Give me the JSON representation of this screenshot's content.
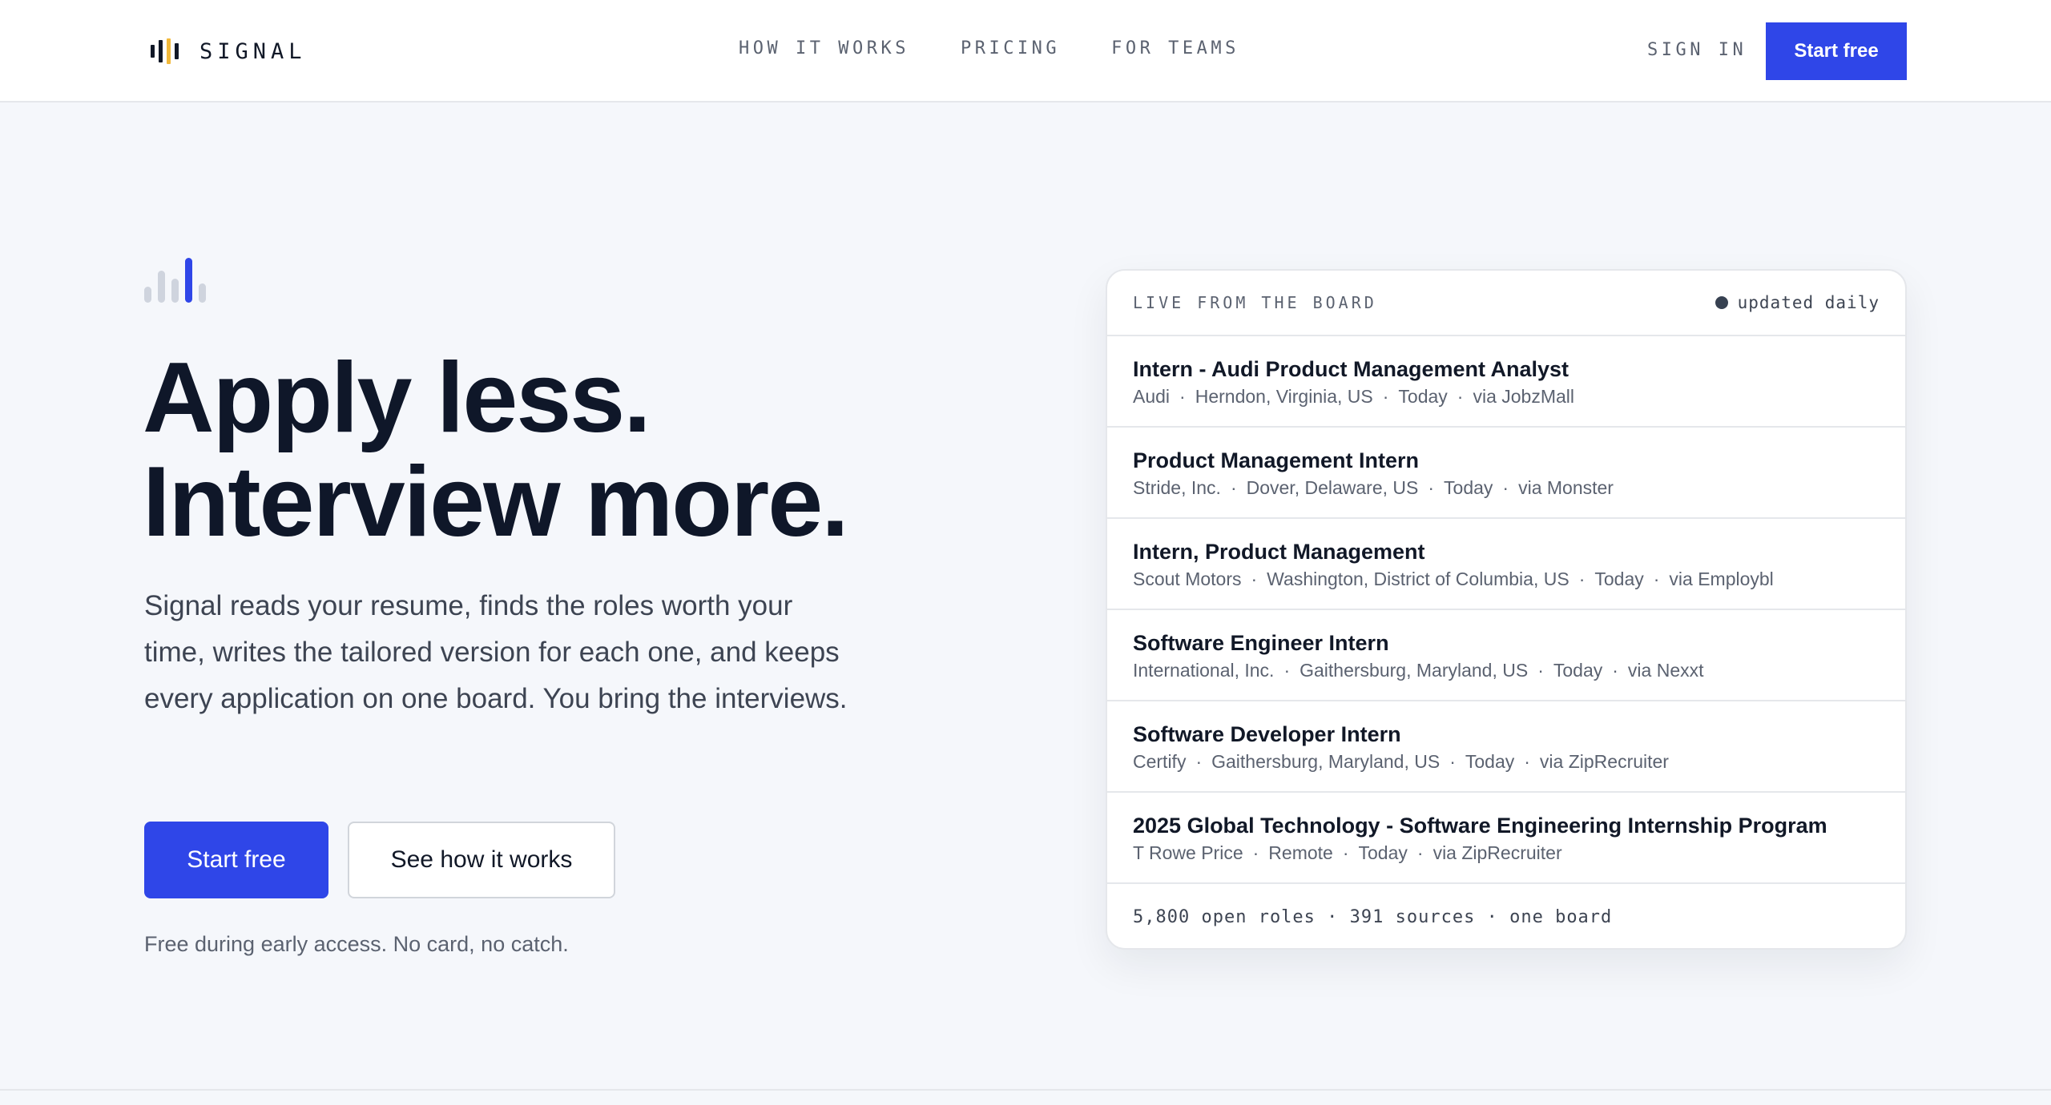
{
  "colors": {
    "accent": "#2f46e8",
    "brand_accent": "#f2b93b",
    "text": "#111827",
    "muted": "#5b6270"
  },
  "nav": {
    "brand": "SIGNAL",
    "links": [
      "HOW IT WORKS",
      "PRICING",
      "FOR TEAMS"
    ],
    "sign_in": "SIGN IN",
    "cta": "Start free"
  },
  "hero": {
    "headline_1": "Apply less.",
    "headline_2": "Interview more.",
    "subcopy": "Signal reads your resume, finds the roles worth your time, writes the tailored version for each one, and keeps every application on one board. You bring the interviews.",
    "primary_cta": "Start free",
    "secondary_cta": "See how it works",
    "note": "Free during early access. No card, no catch."
  },
  "board": {
    "title": "LIVE FROM THE BOARD",
    "status": "updated daily",
    "jobs": [
      {
        "title": "Intern - Audi Product Management Analyst",
        "company": "Audi",
        "location": "Herndon, Virginia, US",
        "posted": "Today",
        "source": "via JobzMall"
      },
      {
        "title": "Product Management Intern",
        "company": "Stride, Inc.",
        "location": "Dover, Delaware, US",
        "posted": "Today",
        "source": "via Monster"
      },
      {
        "title": "Intern, Product Management",
        "company": "Scout Motors",
        "location": "Washington, District of Columbia, US",
        "posted": "Today",
        "source": "via Employbl"
      },
      {
        "title": "Software Engineer Intern",
        "company": "International, Inc.",
        "location": "Gaithersburg, Maryland, US",
        "posted": "Today",
        "source": "via Nexxt"
      },
      {
        "title": "Software Developer Intern",
        "company": "Certify",
        "location": "Gaithersburg, Maryland, US",
        "posted": "Today",
        "source": "via ZipRecruiter"
      },
      {
        "title": "2025 Global Technology - Software Engineering Internship Program",
        "company": "T Rowe Price",
        "location": "Remote",
        "posted": "Today",
        "source": "via ZipRecruiter"
      }
    ],
    "footer": "5,800 open roles · 391 sources · one board"
  }
}
